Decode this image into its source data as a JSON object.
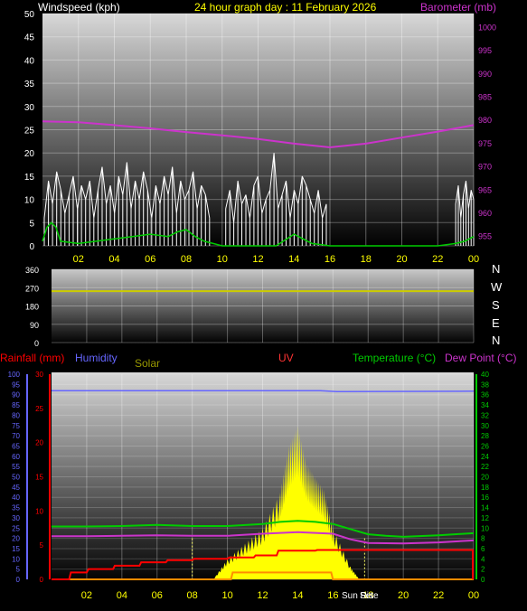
{
  "header": {
    "windspeed_label": "Windspeed (kph)",
    "graph_title": "24 hour graph day : 11 February 2026",
    "barometer_label": "Barometer (mb)"
  },
  "direction_letters": [
    "N",
    "W",
    "S",
    "E",
    "N"
  ],
  "bottom_labels": {
    "rainfall": "Rainfall (mm)",
    "humidity": "Humidity",
    "solar": "Solar",
    "uv": "UV",
    "temperature": "Temperature (°C)",
    "dew_point": "Dew Point (°C)",
    "sun_rise": "Sun Rise",
    "sun_set": "Set"
  },
  "colors": {
    "windspeed_gust": "#ffffff",
    "windspeed_avg": "#00cc00",
    "barometer": "#cc33cc",
    "wind_direction": "#cccc00",
    "rainfall": "#ff0000",
    "humidity": "#6666ff",
    "solar": "#ffff00",
    "uv": "#ff8c00",
    "temperature": "#00cc00",
    "dew_point": "#cc33cc",
    "header_text": "#ffff00",
    "axis_magenta": "#cc33cc",
    "axis_red": "#ff0000",
    "axis_blue": "#6666ff",
    "axis_green": "#00cc00"
  },
  "chart_data": [
    {
      "type": "line",
      "x_ticks": [
        "02",
        "04",
        "06",
        "08",
        "10",
        "12",
        "14",
        "16",
        "18",
        "20",
        "22",
        "00"
      ],
      "y_left_label": "Windspeed (kph)",
      "y_left_ticks": [
        0,
        5,
        10,
        15,
        20,
        25,
        30,
        35,
        40,
        45,
        50
      ],
      "y_left_range": [
        0,
        50
      ],
      "y_right_label": "Barometer (mb)",
      "y_right_ticks": [
        955,
        960,
        965,
        970,
        975,
        980,
        985,
        990,
        995,
        1000
      ],
      "y_right_range": [
        953,
        1003
      ],
      "series": [
        {
          "name": "Barometer (mb)",
          "axis": "right",
          "x_hours": [
            0,
            2,
            4,
            6,
            8,
            10,
            12,
            14,
            16,
            18,
            20,
            22,
            24
          ],
          "values": [
            979.8,
            979.6,
            979.0,
            978.3,
            977.5,
            976.8,
            976.0,
            975.0,
            974.2,
            975.0,
            976.3,
            977.6,
            979.0
          ]
        },
        {
          "name": "Wind Speed (kph)",
          "axis": "left",
          "x_hours": [
            0,
            0.25,
            0.5,
            0.75,
            1,
            2,
            3,
            4,
            5,
            6,
            7,
            7.5,
            8,
            8.5,
            9,
            9.5,
            10,
            12,
            13,
            14,
            14.5,
            15,
            16,
            20,
            22,
            23,
            23.5,
            23.75,
            24
          ],
          "values": [
            1,
            4,
            5,
            4,
            1,
            0.5,
            1,
            1.5,
            2,
            2.5,
            2,
            3,
            3.5,
            2,
            1,
            0.5,
            0,
            0,
            0,
            2.5,
            1.5,
            0.5,
            0,
            0,
            0,
            0.5,
            1,
            1.5,
            2
          ]
        },
        {
          "name": "Gust (kph)",
          "axis": "left",
          "segments": [
            {
              "x_start": 0.1,
              "x_end": 9.3,
              "values": [
                6,
                14,
                9,
                16,
                12,
                7,
                11,
                15,
                8,
                13,
                10,
                14,
                6,
                12,
                17,
                9,
                13,
                7,
                15,
                11,
                18,
                8,
                14,
                10,
                16,
                12,
                6,
                13,
                9,
                15,
                11,
                17,
                7,
                14,
                10,
                12,
                16,
                8,
                13,
                11,
                6
              ]
            },
            {
              "x_start": 10.2,
              "x_end": 15.8,
              "values": [
                8,
                12,
                5,
                14,
                9,
                11,
                6,
                13,
                15,
                7,
                10,
                12,
                20,
                8,
                11,
                14,
                6,
                12,
                9,
                15,
                13,
                10,
                7,
                12,
                6,
                9
              ]
            },
            {
              "x_start": 23.0,
              "x_end": 24.0,
              "values": [
                9,
                13,
                6,
                11,
                14,
                8,
                12,
                10
              ]
            }
          ]
        }
      ]
    },
    {
      "type": "line",
      "x_ticks": [],
      "y_ticks": [
        0,
        90,
        180,
        270,
        360
      ],
      "y_range": [
        0,
        360
      ],
      "series": [
        {
          "name": "Wind Direction (°)",
          "x_hours": [
            0,
            24
          ],
          "values": [
            253,
            253
          ]
        }
      ]
    },
    {
      "type": "line",
      "x_ticks": [
        "02",
        "04",
        "06",
        "08",
        "10",
        "12",
        "14",
        "16",
        "18",
        "20",
        "22",
        "00"
      ],
      "y_humidity_ticks": [
        0,
        5,
        10,
        15,
        20,
        25,
        30,
        35,
        40,
        45,
        50,
        55,
        60,
        65,
        70,
        75,
        80,
        85,
        90,
        95,
        100
      ],
      "y_humidity_range": [
        0,
        100
      ],
      "y_rainfall_ticks": [
        0,
        5,
        10,
        15,
        20,
        25,
        30
      ],
      "y_rainfall_range": [
        0,
        30
      ],
      "y_temperature_ticks": [
        0,
        2,
        4,
        6,
        8,
        10,
        12,
        14,
        16,
        18,
        20,
        22,
        24,
        26,
        28,
        30,
        32,
        34,
        36,
        38,
        40
      ],
      "y_temperature_range": [
        0,
        40
      ],
      "series": [
        {
          "name": "Humidity",
          "x_hours": [
            0,
            15.3,
            16.2,
            24
          ],
          "values": [
            92,
            92,
            91.5,
            91.7
          ]
        },
        {
          "name": "Temperature (°C)",
          "x_hours": [
            0,
            2,
            4,
            6,
            8,
            10,
            12,
            13,
            14,
            15,
            16,
            17,
            18,
            19,
            20,
            22,
            24
          ],
          "values": [
            10.3,
            10.3,
            10.4,
            10.6,
            10.4,
            10.4,
            10.8,
            11.2,
            11.4,
            11.2,
            10.8,
            9.8,
            8.8,
            8.5,
            8.3,
            8.6,
            9.0
          ]
        },
        {
          "name": "Dew Point (°C)",
          "x_hours": [
            0,
            2,
            4,
            6,
            8,
            10,
            12,
            14,
            16,
            17,
            18,
            20,
            22,
            24
          ],
          "values": [
            8.4,
            8.4,
            8.5,
            8.6,
            8.5,
            8.5,
            8.9,
            9.2,
            8.9,
            7.8,
            7.1,
            7.0,
            7.2,
            7.6
          ]
        },
        {
          "name": "Rainfall (mm)",
          "x_hours": [
            0,
            1.0,
            1.1,
            2.0,
            2.1,
            3.5,
            3.6,
            5.0,
            5.1,
            6.5,
            6.6,
            8.0,
            8.1,
            10.0,
            10.1,
            11.5,
            11.6,
            12.8,
            12.9,
            15.0,
            15.1,
            24.0
          ],
          "values": [
            0,
            0,
            1.0,
            1.0,
            1.5,
            1.5,
            2.0,
            2.0,
            2.5,
            2.5,
            2.8,
            2.8,
            3.0,
            3.0,
            3.2,
            3.2,
            3.5,
            3.5,
            4.2,
            4.2,
            4.3,
            4.3
          ]
        },
        {
          "name": "UV",
          "x_hours": [
            0,
            10.2,
            10.3,
            15.9,
            16.0,
            24
          ],
          "values": [
            0,
            0,
            1,
            1,
            0,
            0
          ]
        },
        {
          "name": "Solar",
          "x_hours": [
            9.2,
            10,
            11,
            12,
            13,
            13.5,
            14,
            14.5,
            15,
            15.5,
            16,
            17,
            17.5
          ],
          "values": [
            0,
            8,
            14,
            20,
            34,
            52,
            60,
            45,
            40,
            35,
            20,
            5,
            0
          ]
        }
      ],
      "markers": [
        {
          "label": "Sun Rise",
          "x_hour": 8.0
        },
        {
          "label": "Set",
          "x_hour": 17.8
        }
      ]
    }
  ]
}
